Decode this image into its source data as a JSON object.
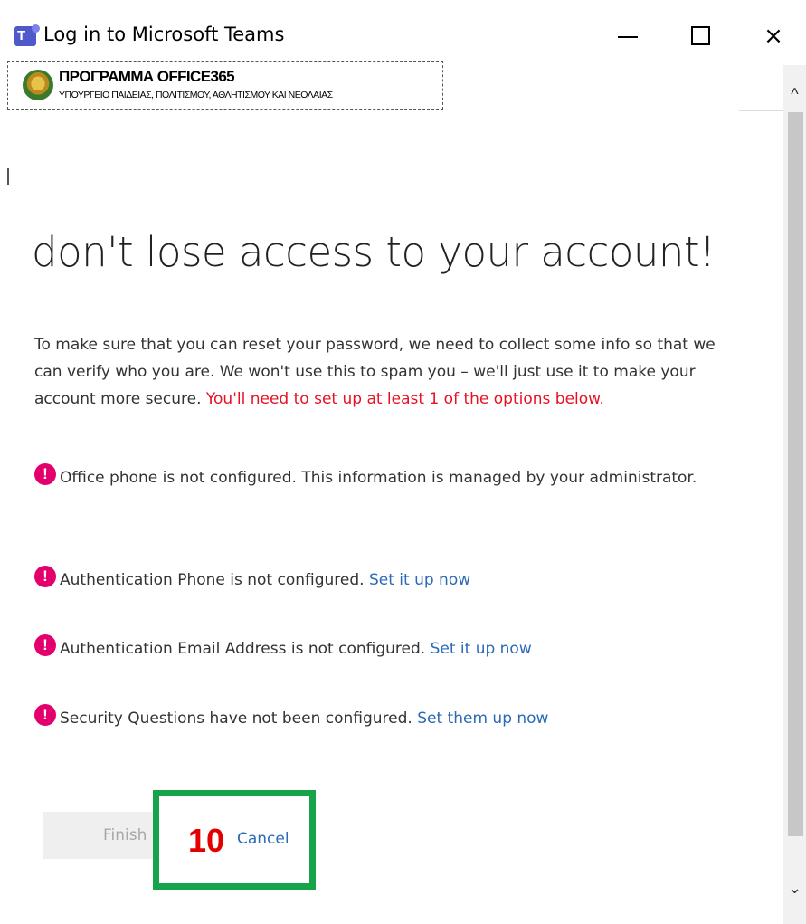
{
  "window": {
    "title": "Log in to Microsoft Teams",
    "app_icon": "teams-icon",
    "app_icon_letter": "T",
    "controls": {
      "minimize": "minimize-icon",
      "maximize": "maximize-icon",
      "close": "×"
    }
  },
  "banner": {
    "title": "ΠΡΟΓΡΑΜΜΑ OFFICE365",
    "subtitle": "ΥΠΟΥΡΓΕΙΟ ΠΑΙΔΕΙΑΣ, ΠΟΛΙΤΙΣΜΟΥ, ΑΘΛΗΤΙΣΜΟΥ ΚΑΙ ΝΕΟΛΑΙΑΣ"
  },
  "main": {
    "heading": "don't lose access to your account!",
    "intro": "To make sure that you can reset your password, we need to collect some info so that we can verify who you are. We won't use this to spam you – we'll just use it to make your account more secure.",
    "intro_warning": "You'll need to set up at least 1 of the options below.",
    "alert_glyph": "!",
    "items": [
      {
        "text": "Office phone is not configured. This information is managed by your administrator.",
        "link": ""
      },
      {
        "text": "Authentication Phone is not configured.",
        "link": "Set it up now"
      },
      {
        "text": "Authentication Email Address is not configured.",
        "link": "Set it up now"
      },
      {
        "text": "Security Questions have not been configured.",
        "link": "Set them up now"
      }
    ]
  },
  "actions": {
    "finish_label": "Finish",
    "cancel_label": "Cancel",
    "step_number": "10"
  },
  "scrollbar": {
    "up_glyph": "^",
    "down_glyph": "⌄"
  },
  "colors": {
    "accent_link": "#2b6ab7",
    "warning": "#e81123",
    "alert_icon": "#e3006d",
    "highlight": "#16a34a",
    "step_number": "#e30000"
  }
}
